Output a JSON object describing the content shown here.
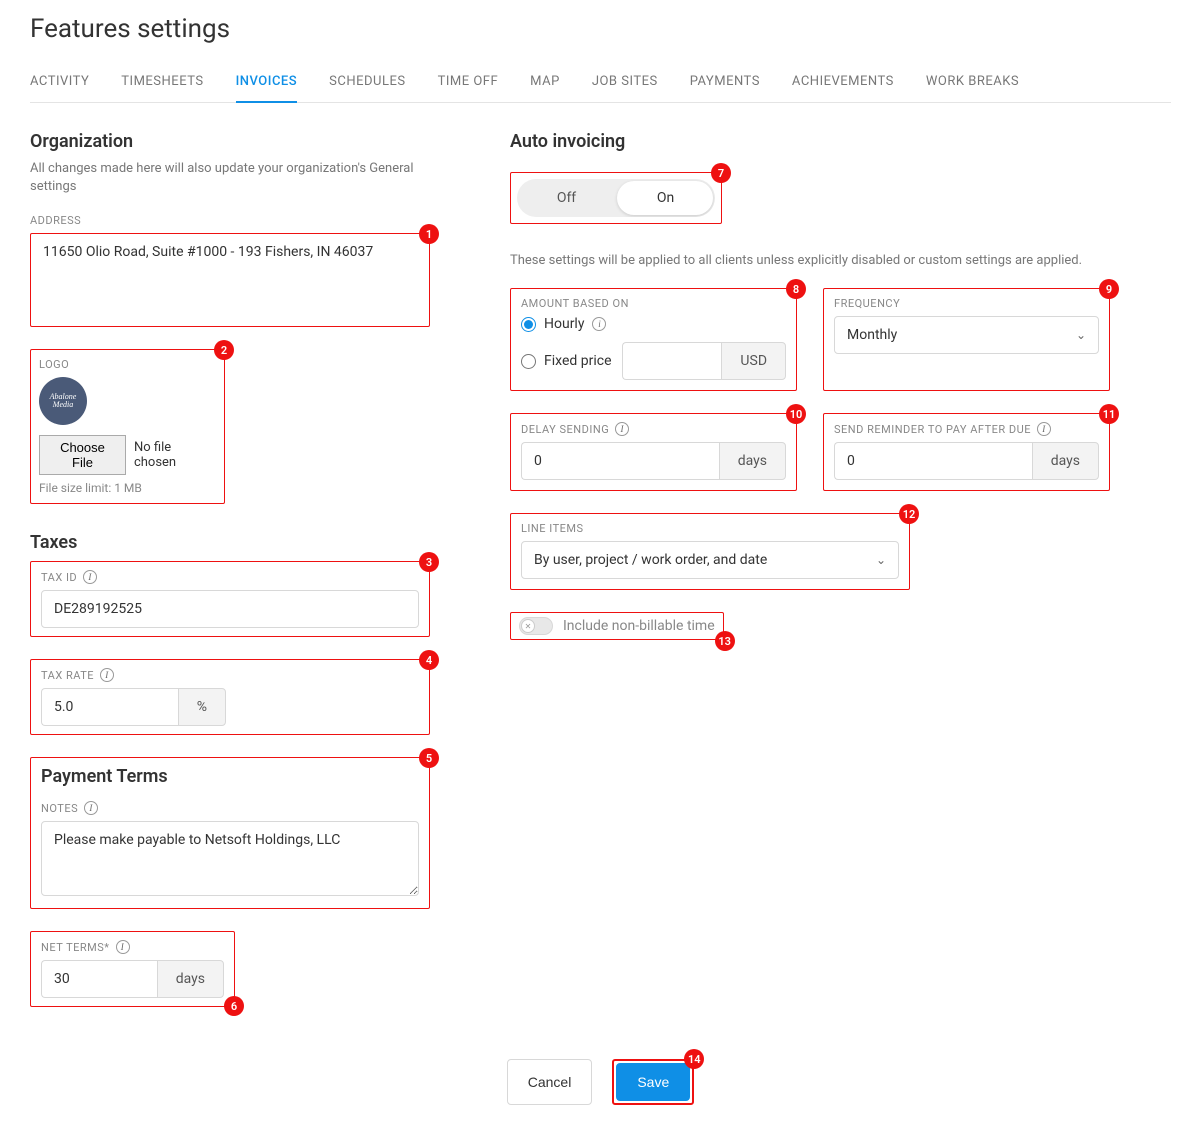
{
  "page_title": "Features settings",
  "tabs": {
    "items": [
      "ACTIVITY",
      "TIMESHEETS",
      "INVOICES",
      "SCHEDULES",
      "TIME OFF",
      "MAP",
      "JOB SITES",
      "PAYMENTS",
      "ACHIEVEMENTS",
      "WORK BREAKS"
    ],
    "active_index": 2
  },
  "organization": {
    "title": "Organization",
    "subtitle": "All changes made here will also update your organization's General settings",
    "address_label": "ADDRESS",
    "address_value": "11650 Olio Road, Suite #1000 - 193 Fishers, IN 46037",
    "logo_label": "LOGO",
    "logo_text": "Abalone Media",
    "choose_file_label": "Choose File",
    "no_file_text": "No file chosen",
    "file_limit": "File size limit: 1 MB"
  },
  "taxes": {
    "title": "Taxes",
    "tax_id_label": "TAX ID",
    "tax_id_value": "DE289192525",
    "tax_rate_label": "TAX RATE",
    "tax_rate_value": "5.0",
    "tax_rate_suffix": "%"
  },
  "payment_terms": {
    "title": "Payment Terms",
    "notes_label": "NOTES",
    "notes_value": "Please make payable to Netsoft Holdings, LLC",
    "net_terms_label": "NET TERMS*",
    "net_terms_value": "30",
    "net_terms_suffix": "days"
  },
  "auto_invoicing": {
    "title": "Auto invoicing",
    "toggle_off": "Off",
    "toggle_on": "On",
    "toggle_state": "On",
    "subtext": "These settings will be applied to all clients unless explicitly disabled or custom settings are applied.",
    "amount_based_on_label": "AMOUNT BASED ON",
    "hourly_label": "Hourly",
    "fixed_price_label": "Fixed price",
    "fixed_price_value": "",
    "fixed_price_suffix": "USD",
    "frequency_label": "FREQUENCY",
    "frequency_value": "Monthly",
    "delay_sending_label": "DELAY SENDING",
    "delay_sending_value": "0",
    "delay_sending_suffix": "days",
    "send_reminder_label": "SEND REMINDER TO PAY AFTER DUE",
    "send_reminder_value": "0",
    "send_reminder_suffix": "days",
    "line_items_label": "LINE ITEMS",
    "line_items_value": "By user, project / work order, and date",
    "include_nonbillable_label": "Include non-billable time",
    "include_nonbillable_value": false
  },
  "footer": {
    "cancel": "Cancel",
    "save": "Save"
  },
  "annotations": {
    "n1": "1",
    "n2": "2",
    "n3": "3",
    "n4": "4",
    "n5": "5",
    "n6": "6",
    "n7": "7",
    "n8": "8",
    "n9": "9",
    "n10": "10",
    "n11": "11",
    "n12": "12",
    "n13": "13",
    "n14": "14"
  }
}
